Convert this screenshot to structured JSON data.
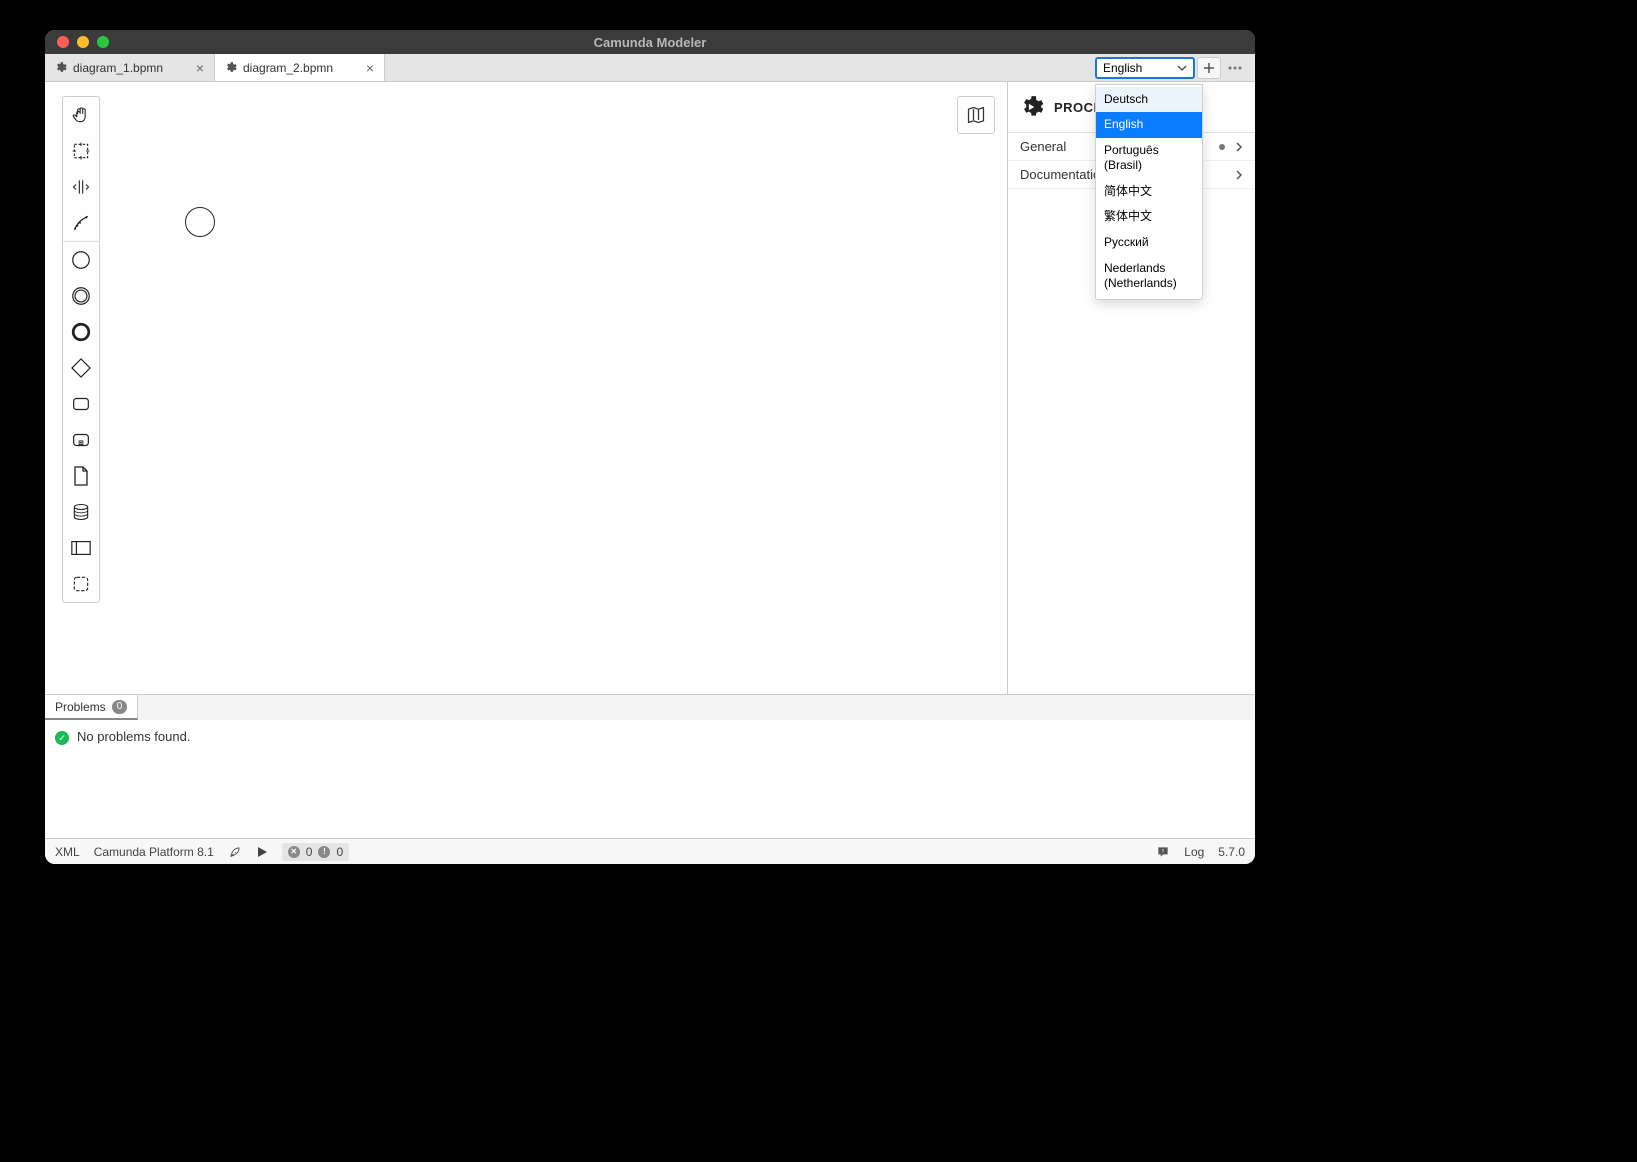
{
  "window": {
    "title": "Camunda Modeler"
  },
  "tabs": [
    {
      "label": "diagram_1.bpmn",
      "active": false
    },
    {
      "label": "diagram_2.bpmn",
      "active": true
    }
  ],
  "language": {
    "selected": "English",
    "options": [
      "Deutsch",
      "English",
      "Português (Brasil)",
      "简体中文",
      "繁体中文",
      "Русский",
      "Nederlands (Netherlands)"
    ]
  },
  "palette": {
    "tools": [
      "hand-tool",
      "lasso-tool",
      "space-tool",
      "global-connect-tool",
      "start-event",
      "intermediate-event",
      "end-event",
      "gateway",
      "task",
      "subprocess",
      "data-object",
      "data-store",
      "participant",
      "group"
    ]
  },
  "propertiesPanel": {
    "title": "PROCESS",
    "groups": [
      {
        "label": "General",
        "hasDot": true
      },
      {
        "label": "Documentation",
        "hasDot": false
      }
    ]
  },
  "problems": {
    "tabLabel": "Problems",
    "count": "0",
    "message": "No problems found."
  },
  "statusbar": {
    "xml": "XML",
    "platform": "Camunda Platform 8.1",
    "errors": "0",
    "warnings": "0",
    "log": "Log",
    "version": "5.7.0"
  }
}
